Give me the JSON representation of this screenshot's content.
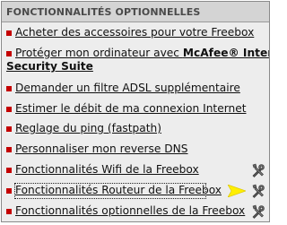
{
  "panel": {
    "title": "FONCTIONNALITÉS OPTIONNELLES"
  },
  "items": [
    {
      "label": "Acheter des accessoires pour votre Freebox"
    },
    {
      "label_part1": "Protéger mon ordinateur avec ",
      "label_bold1": "McAfee® Internet",
      "label_bold2": "Security Suite"
    },
    {
      "label": "Demander un filtre ADSL supplémentaire"
    },
    {
      "label": "Estimer le débit de ma connexion Internet"
    },
    {
      "label": "Reglage du ping (fastpath)"
    },
    {
      "label": "Personnaliser mon reverse DNS"
    },
    {
      "label": "Fonctionnalités Wifi de la Freebox",
      "icon": "tools-icon"
    },
    {
      "label": "Fonctionnalités Routeur de la Freebox",
      "icon": "tools-icon",
      "marker": "yellow-arrow-icon"
    },
    {
      "label": "Fonctionnalités optionnelles de la Freebox",
      "icon": "tools-icon"
    }
  ],
  "colors": {
    "bullet": "#c40000",
    "arrow": "#ffee00",
    "panel_bg": "#ededed",
    "header_bg": "#d4d4d4"
  }
}
